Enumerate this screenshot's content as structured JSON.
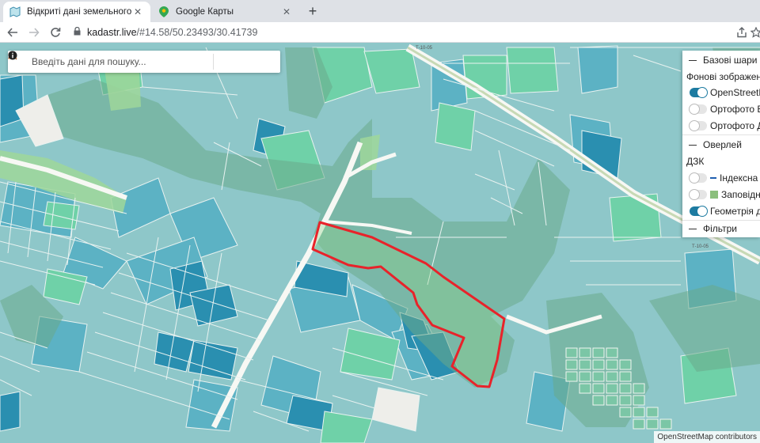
{
  "browser": {
    "tabs": [
      {
        "title": "Відкриті дані земельного кадастру",
        "favicon": "map-favicon",
        "active": true
      },
      {
        "title": "Google Карты",
        "favicon": "google-maps-favicon",
        "active": false
      }
    ],
    "new_tab_symbol": "+",
    "close_symbol": "✕",
    "address": {
      "host": "kadastr.live",
      "path": "/#14.58/50.23493/30.41739"
    }
  },
  "search": {
    "placeholder": "Введіть дані для пошуку..."
  },
  "layers_panel": {
    "base_layers_title": "Базові шари",
    "background_label": "Фонові зображення",
    "base_options": [
      {
        "label": "OpenStreetMap",
        "on": true
      },
      {
        "label": "Ортофото ESRI",
        "on": false
      },
      {
        "label": "Ортофото Д",
        "on": false
      }
    ],
    "overlays_title": "Оверлей",
    "dzk_label": "ДЗК",
    "overlay_options": [
      {
        "label": "Індексна карта",
        "on": false,
        "symbol": "line",
        "color": "#1f5fb0"
      },
      {
        "label": "Заповідник",
        "on": false,
        "symbol": "square",
        "color": "#8bbf7d"
      },
      {
        "label": "Геометрія ділянок",
        "on": true,
        "symbol": "none",
        "color": ""
      }
    ],
    "filters_title": "Фільтри"
  },
  "map": {
    "road_labels": [
      "Т-10-05",
      "Т-10-05"
    ],
    "highlight_color": "#e8232a",
    "colors": {
      "parcel_light": "#8ec8cc",
      "parcel_mid": "#5cb2c4",
      "parcel_dark": "#2a8fb0",
      "parcel_green": "#6fd1a8",
      "reserve": "#78b88f",
      "road": "#f4f6f2"
    }
  },
  "attribution": "OpenStreetMap contributors"
}
